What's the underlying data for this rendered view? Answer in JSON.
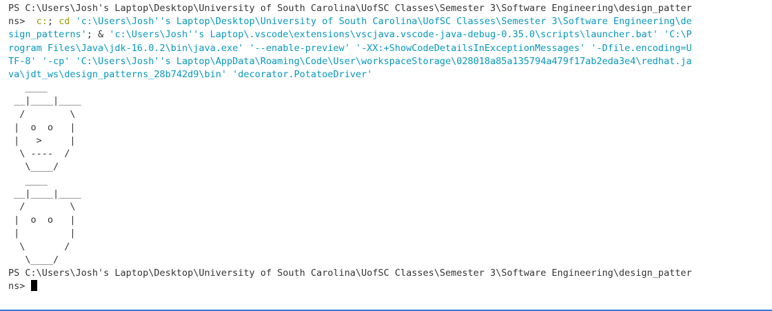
{
  "terminal": {
    "prompt_line1": "PS C:\\Users\\Josh's Laptop\\Desktop\\University of South Carolina\\UofSC Classes\\Semester 3\\Software Engineering\\design_patter",
    "prompt_line2_prefix": "ns>  ",
    "cmd_c": "c:",
    "cmd_sep1": "; ",
    "cmd_cd": "cd",
    "cmd_path1": " 'c:\\Users\\Josh''s Laptop\\Desktop\\University of South Carolina\\UofSC Classes\\Semester 3\\Software Engineering\\de",
    "cmd_line3": "sign_patterns'",
    "cmd_line3_rest": "; & ",
    "cmd_line3_str": "'c:\\Users\\Josh''s Laptop\\.vscode\\extensions\\vscjava.vscode-java-debug-0.35.0\\scripts\\launcher.bat' 'C:\\P",
    "cmd_line4": "rogram Files\\Java\\jdk-16.0.2\\bin\\java.exe' '--enable-preview' '-XX:+ShowCodeDetailsInExceptionMessages' '-Dfile.encoding=U",
    "cmd_line5": "TF-8' '-cp' 'C:\\Users\\Josh''s Laptop\\AppData\\Roaming\\Code\\User\\workspaceStorage\\028018a85a135794a479f17ab2eda3e4\\redhat.ja",
    "cmd_line6": "va\\jdt_ws\\design_patterns_28b742d9\\bin' 'decorator.PotatoeDriver'",
    "ascii_art_1": "   ____\n __|____|____\n  /        \\\n |  o  o   |\n |   >     |\n  \\ ----  /\n   \\____/",
    "ascii_art_2": "   ____\n __|____|____\n  /        \\\n |  o  o   |\n |         |\n  \\       /\n   \\____/",
    "final_prompt_line1": "PS C:\\Users\\Josh's Laptop\\Desktop\\University of South Carolina\\UofSC Classes\\Semester 3\\Software Engineering\\design_patter",
    "final_prompt_line2": "ns> "
  },
  "colors": {
    "text": "#333333",
    "command_yellow": "#949800",
    "string_teal": "#0598bc",
    "accent_bar": "#2f7bd6"
  }
}
